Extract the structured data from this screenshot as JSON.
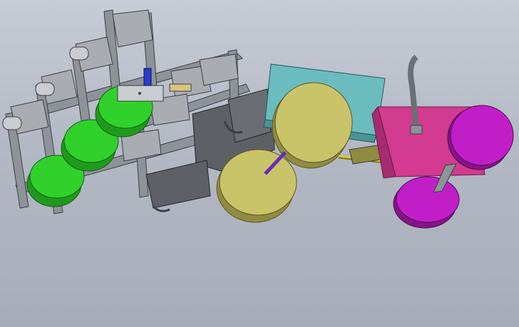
{
  "viewport": {
    "background_top": "#c7ccd6",
    "background_bottom": "#a7adb8"
  },
  "model": {
    "colors": {
      "frame": "#8e9399",
      "frame_dark": "#6b7076",
      "hopper": "#a9adb2",
      "green_wheel": "#2fd12a",
      "green_wheel_dark": "#1f9a1c",
      "olive_wheel": "#c9c46a",
      "olive_wheel_dark": "#8f8b40",
      "purple_wheel": "#c21ec8",
      "purple_wheel_dark": "#861489",
      "pink_box": "#d23b8f",
      "teal_tray": "#6bbcbf",
      "gray_shield": "#5d6166",
      "yellow_rod": "#d7cf3a"
    }
  }
}
